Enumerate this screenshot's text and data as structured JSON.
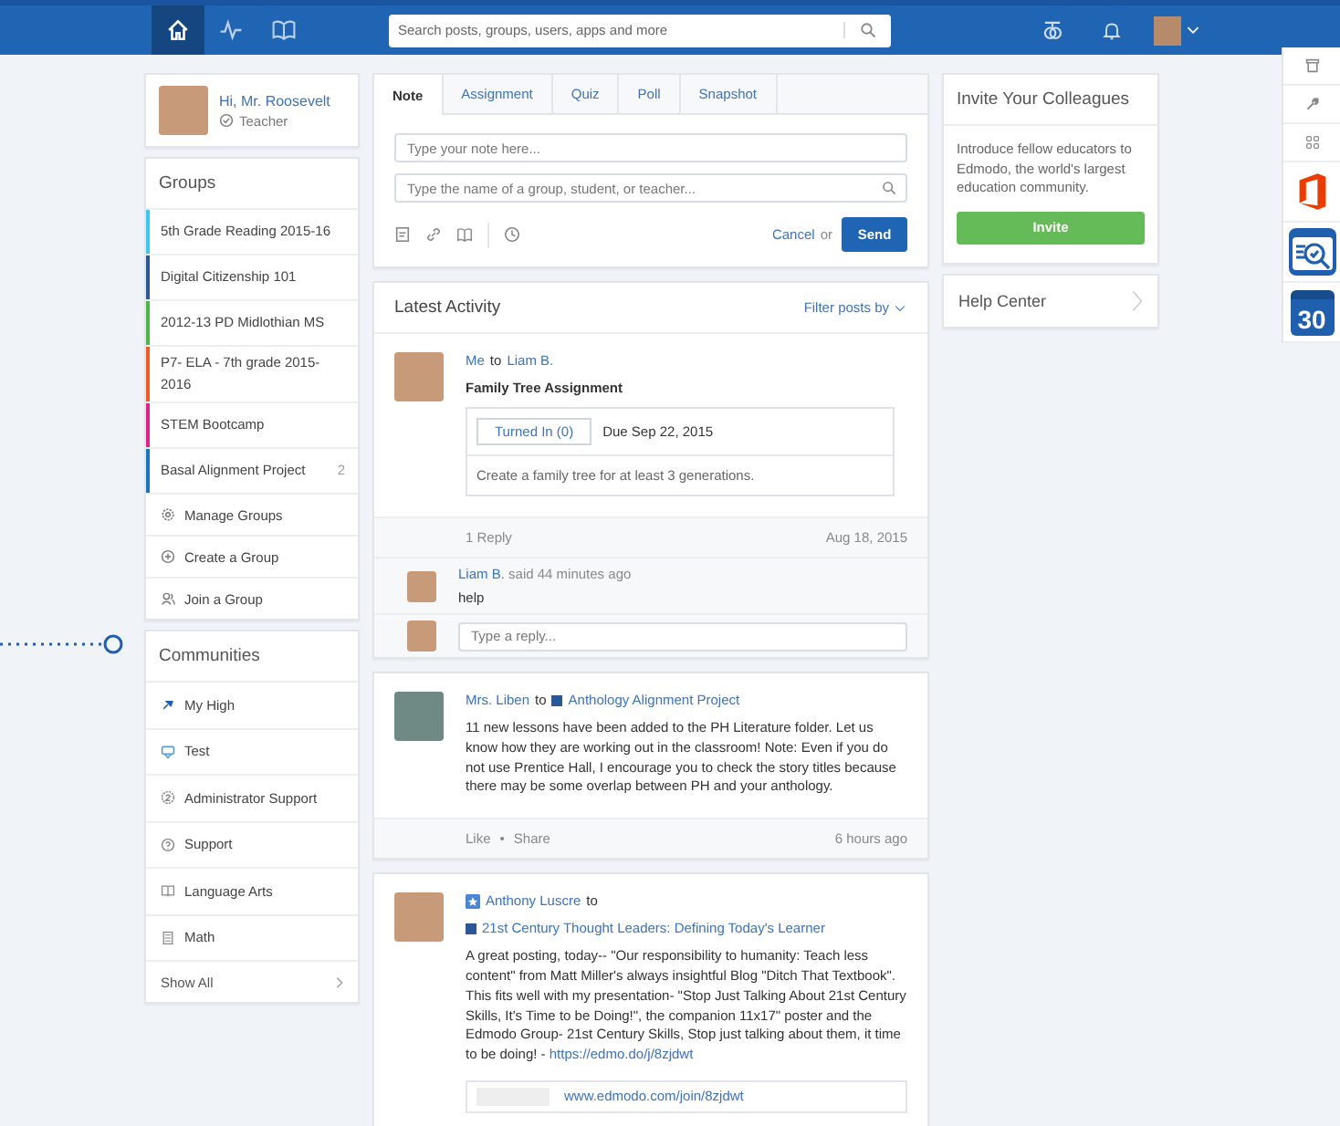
{
  "topbar": {
    "nav": [
      {
        "kind": "home",
        "selected": true
      },
      {
        "kind": "pulse",
        "selected": false
      },
      {
        "kind": "book",
        "selected": false
      }
    ],
    "search": {
      "placeholder": "Search posts, groups, users, apps and more"
    }
  },
  "profile": {
    "greeting": "Hi, Mr. Roosevelt",
    "role": "Teacher"
  },
  "groups": {
    "title": "Groups",
    "items": [
      {
        "name": "5th Grade Reading 2015-16",
        "color": "#3cc6f0"
      },
      {
        "name": "Digital Citizenship 101",
        "color": "#2b5797"
      },
      {
        "name": "2012-13 PD Midlothian MS",
        "color": "#4bb748"
      },
      {
        "name": "P7- ELA - 7th grade 2015-2016",
        "color": "#f05a28"
      },
      {
        "name": "STEM Bootcamp",
        "color": "#e0218a"
      },
      {
        "name": "Basal Alignment Project",
        "color": "#1b75bc",
        "count": "2"
      }
    ],
    "actions": [
      {
        "kind": "gear",
        "label": "Manage Groups"
      },
      {
        "kind": "plus",
        "label": "Create a Group"
      },
      {
        "kind": "people",
        "label": "Join a Group"
      }
    ]
  },
  "communities": {
    "title": "Communities",
    "items": [
      {
        "kind": "pin",
        "label": "My High"
      },
      {
        "kind": "tag",
        "label": "Test"
      },
      {
        "kind": "badge",
        "label": "Administrator Support"
      },
      {
        "kind": "help",
        "label": "Support"
      },
      {
        "kind": "book",
        "label": "Language Arts"
      },
      {
        "kind": "calc",
        "label": "Math"
      }
    ],
    "show_all": "Show All"
  },
  "composer": {
    "tabs": [
      {
        "label": "Note",
        "selected": true
      },
      {
        "label": "Assignment",
        "selected": false
      },
      {
        "label": "Quiz",
        "selected": false
      },
      {
        "label": "Poll",
        "selected": false
      },
      {
        "label": "Snapshot",
        "selected": false
      }
    ],
    "note_placeholder": "Type your note here...",
    "recipient_placeholder": "Type the name of a group, student, or teacher...",
    "cancel": "Cancel",
    "or": "or",
    "send": "Send"
  },
  "activity": {
    "title": "Latest Activity",
    "filter": "Filter posts by"
  },
  "post1": {
    "sender": "Me",
    "to": "to",
    "recipient": "Liam B.",
    "title": "Family Tree Assignment",
    "turned_in": "Turned In (0)",
    "due": "Due Sep 22, 2015",
    "description": "Create a family tree for at least 3 generations.",
    "replies": "1 Reply",
    "date": "Aug 18, 2015",
    "reply": {
      "author": "Liam B.",
      "said": "said 44 minutes ago",
      "text": "help"
    },
    "reply_placeholder": "Type a reply..."
  },
  "post2": {
    "author": "Mrs. Liben",
    "to": "to",
    "group": "Anthology Alignment Project",
    "body": "11 new lessons have been added to the PH Literature folder. Let us know how they are working out in the classroom! Note: Even if you do not use Prentice Hall, I encourage you to check the story titles because there may be some overlap between PH and your anthology.",
    "actions": [
      "Like",
      "Share"
    ],
    "separator": "•",
    "time": "6 hours ago"
  },
  "post3": {
    "author": "Anthony Luscre",
    "to": "to",
    "group": "21st Century Thought Leaders: Defining Today's Learner",
    "body": "A great posting, today-- \"Our responsibility to humanity: Teach less content\" from Matt Miller's always insightful Blog \"Ditch That Textbook\". This fits well with my presentation- \"Stop Just Talking About 21st Century Skills, It's Time to be Doing!\", the companion 11x17\" poster and the Edmodo Group- 21st Century Skills, Stop just talking about them, it time to be doing! -",
    "link": "https://edmo.do/j/8zjdwt",
    "preview": "www.edmodo.com/join/8zjdwt"
  },
  "invite": {
    "title": "Invite Your Colleagues",
    "text": "Introduce fellow educators to Edmodo, the world's largest education community.",
    "button": "Invite"
  },
  "help": {
    "label": "Help Center"
  },
  "rail": [
    {
      "kind": "store"
    },
    {
      "kind": "wrench"
    },
    {
      "kind": "grid"
    },
    {
      "kind": "office"
    },
    {
      "kind": "quiz"
    },
    {
      "kind": "calendar",
      "text": "30"
    }
  ]
}
